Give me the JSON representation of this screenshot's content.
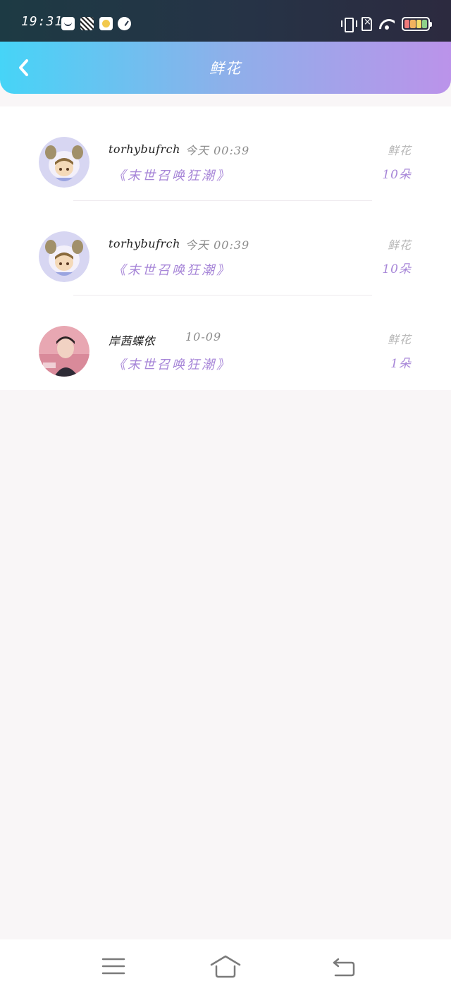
{
  "status_bar": {
    "time": "19:31",
    "app_icons": [
      "shopping-bag-icon",
      "game-app-icon",
      "emoji-app-icon",
      "speedometer-icon"
    ],
    "indicators": [
      "vibrate-icon",
      "sim-absent-icon",
      "wifi-icon",
      "battery-icon"
    ]
  },
  "header": {
    "title": "鲜花",
    "back_icon": "chevron-left-icon",
    "gradient": [
      "#46d4f7",
      "#bb93ea"
    ]
  },
  "records": [
    {
      "avatar": "anime-avatar-icon",
      "name": "torhybufrch",
      "time": "今天 00:39",
      "book": "《末世召唤狂潮》",
      "gift": "鲜花",
      "count": "10朵"
    },
    {
      "avatar": "anime-avatar-icon",
      "name": "torhybufrch",
      "time": "今天 00:39",
      "book": "《末世召唤狂潮》",
      "gift": "鲜花",
      "count": "10朵"
    },
    {
      "avatar": "photo-avatar-icon",
      "name": "岸茜蝶依",
      "time": "10-09",
      "book": "《末世召唤狂潮》",
      "gift": "鲜花",
      "count": "1朵"
    }
  ],
  "colors": {
    "accent": "#a786d8",
    "background": "#f9f6f7"
  },
  "nav_bar": [
    "menu-icon",
    "home-icon",
    "back-icon"
  ]
}
